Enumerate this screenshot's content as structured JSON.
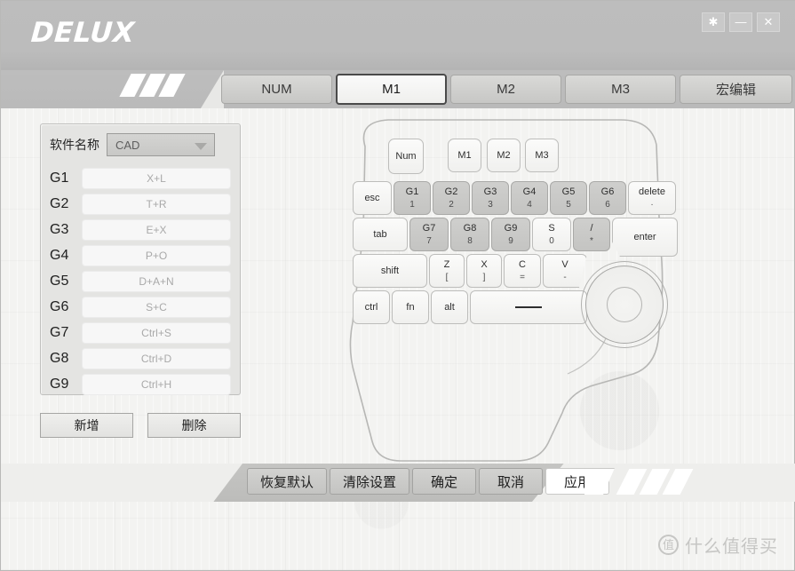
{
  "window": {
    "logo": "DELUX",
    "controls": [
      {
        "name": "settings",
        "glyph": "✱"
      },
      {
        "name": "minimize",
        "glyph": "—"
      },
      {
        "name": "close",
        "glyph": "✕"
      }
    ]
  },
  "tabs": [
    {
      "label": "NUM",
      "active": false
    },
    {
      "label": "M1",
      "active": true
    },
    {
      "label": "M2",
      "active": false
    },
    {
      "label": "M3",
      "active": false
    },
    {
      "label": "宏编辑",
      "active": false
    }
  ],
  "panel": {
    "software_label": "软件名称",
    "software_value": "CAD",
    "bindings": [
      {
        "key": "G1",
        "value": "X+L"
      },
      {
        "key": "G2",
        "value": "T+R"
      },
      {
        "key": "G3",
        "value": "E+X"
      },
      {
        "key": "G4",
        "value": "P+O"
      },
      {
        "key": "G5",
        "value": "D+A+N"
      },
      {
        "key": "G6",
        "value": "S+C"
      },
      {
        "key": "G7",
        "value": "Ctrl+S"
      },
      {
        "key": "G8",
        "value": "Ctrl+D"
      },
      {
        "key": "G9",
        "value": "Ctrl+H"
      }
    ],
    "add_label": "新增",
    "delete_label": "删除"
  },
  "device": {
    "mode_keys": [
      {
        "label": "Num"
      },
      {
        "label": "M1"
      },
      {
        "label": "M2"
      },
      {
        "label": "M3"
      }
    ],
    "row1": [
      {
        "label": "esc",
        "sub": "",
        "hl": false
      },
      {
        "label": "G1",
        "sub": "1",
        "hl": true
      },
      {
        "label": "G2",
        "sub": "2",
        "hl": true
      },
      {
        "label": "G3",
        "sub": "3",
        "hl": true
      },
      {
        "label": "G4",
        "sub": "4",
        "hl": true
      },
      {
        "label": "G5",
        "sub": "5",
        "hl": true
      },
      {
        "label": "G6",
        "sub": "6",
        "hl": true
      },
      {
        "label": "delete",
        "sub": "·",
        "hl": false
      }
    ],
    "row2": [
      {
        "label": "tab",
        "sub": "",
        "hl": false
      },
      {
        "label": "G7",
        "sub": "7",
        "hl": true
      },
      {
        "label": "G8",
        "sub": "8",
        "hl": true
      },
      {
        "label": "G9",
        "sub": "9",
        "hl": true
      },
      {
        "label": "S",
        "sub": "0",
        "hl": false
      },
      {
        "label": "/",
        "sub": "*",
        "hl": true
      }
    ],
    "enter_label": "enter",
    "row3": [
      {
        "label": "shift",
        "sub": "",
        "hl": false
      },
      {
        "label": "Z",
        "sub": "[",
        "hl": false
      },
      {
        "label": "X",
        "sub": "]",
        "hl": false
      },
      {
        "label": "C",
        "sub": "=",
        "hl": false
      },
      {
        "label": "V",
        "sub": "-",
        "hl": false
      }
    ],
    "row4": [
      {
        "label": "ctrl",
        "sub": "",
        "hl": false
      },
      {
        "label": "fn",
        "sub": "",
        "hl": false
      },
      {
        "label": "alt",
        "sub": "",
        "hl": false
      }
    ]
  },
  "footer": {
    "buttons": [
      {
        "label": "恢复默认",
        "active": false
      },
      {
        "label": "清除设置",
        "active": false
      },
      {
        "label": "确定",
        "active": false
      },
      {
        "label": "取消",
        "active": false
      },
      {
        "label": "应用",
        "active": true
      }
    ]
  },
  "watermark": {
    "badge": "值",
    "text": "什么值得买"
  }
}
